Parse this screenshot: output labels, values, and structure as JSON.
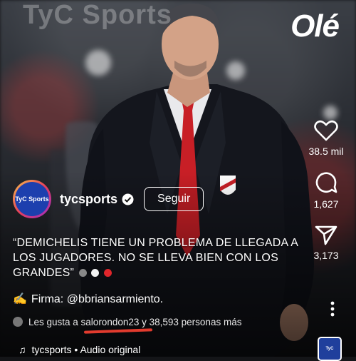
{
  "watermark": "TyC Sports",
  "brand_logo": "Olé",
  "actions": [
    {
      "icon": "heart-icon",
      "count": "38.5 mil"
    },
    {
      "icon": "comment-icon",
      "count": "1,627"
    },
    {
      "icon": "share-icon",
      "count": "3,173"
    }
  ],
  "author": {
    "avatar_text": "TyC Sports",
    "handle": "tycsports",
    "follow_label": "Seguir"
  },
  "caption": "“DEMICHELIS TIENE UN PROBLEMA DE LLEGADA A LOS JUGADORES. NO SE LLEVA BIEN CON LOS GRANDES”",
  "firma": "Firma: @bbriansarmiento.",
  "likes_text": "Les gusta a salorondon23 y 38,593 personas más",
  "audio": {
    "account": "tycsports",
    "separator": "•",
    "label": "Audio original"
  },
  "thumbnail_text": "TyC Sports",
  "colors": {
    "follow_border": "#ffffff",
    "underline": "#e23b2e",
    "tie": "#c81f26"
  }
}
